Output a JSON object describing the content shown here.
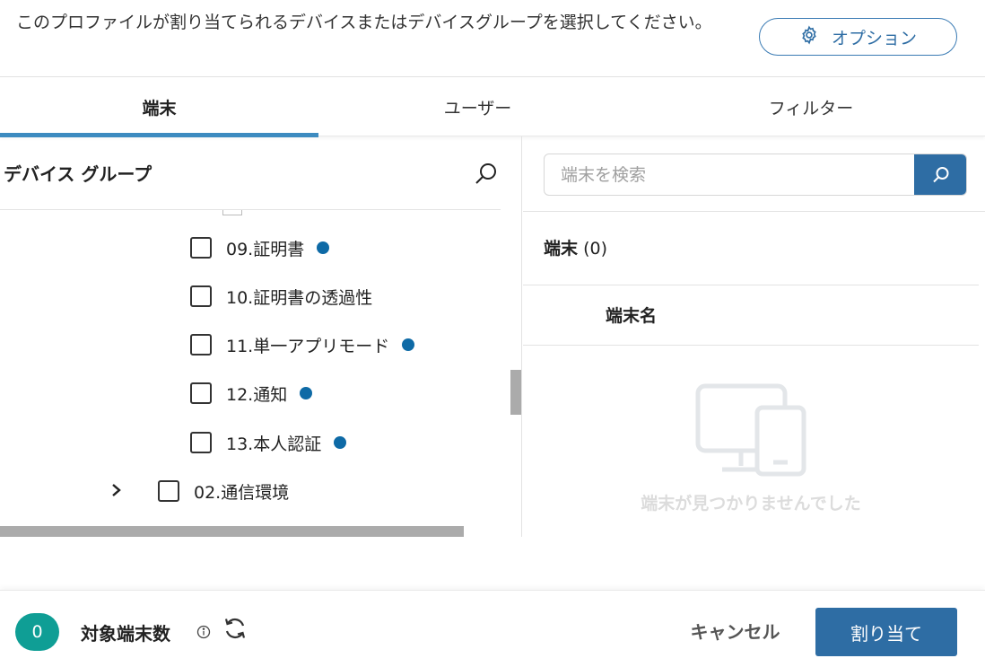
{
  "header": {
    "description": "このプロファイルが割り当てられるデバイスまたはデバイスグループを選択してください。",
    "options_label": "オプション",
    "options_icon": "gear-icon"
  },
  "tabs": [
    {
      "label": "端末",
      "active": true
    },
    {
      "label": "ユーザー",
      "active": false
    },
    {
      "label": "フィルター",
      "active": false
    }
  ],
  "device_group_panel": {
    "title": "デバイス グループ",
    "search_icon": "search-icon",
    "items": [
      {
        "label": "09.証明書",
        "has_dot": true
      },
      {
        "label": "10.証明書の透過性",
        "has_dot": false
      },
      {
        "label": "11.単一アプリモード",
        "has_dot": true
      },
      {
        "label": "12.通知",
        "has_dot": true
      },
      {
        "label": "13.本人認証",
        "has_dot": true
      },
      {
        "label": "02.通信環境",
        "has_dot": false,
        "collapsed": true
      }
    ]
  },
  "device_panel": {
    "search_placeholder": "端末を検索",
    "count_label": "端末",
    "count_value": "(0)",
    "column_header": "端末名",
    "empty_message": "端末が見つかりませんでした"
  },
  "footer": {
    "target_count": "0",
    "target_label": "対象端末数",
    "cancel_label": "キャンセル",
    "assign_label": "割り当て"
  },
  "colors": {
    "accent": "#2e6da4",
    "tab_indicator": "#3d8bc0",
    "badge": "#0f9e95",
    "dot": "#0e6aa6"
  }
}
